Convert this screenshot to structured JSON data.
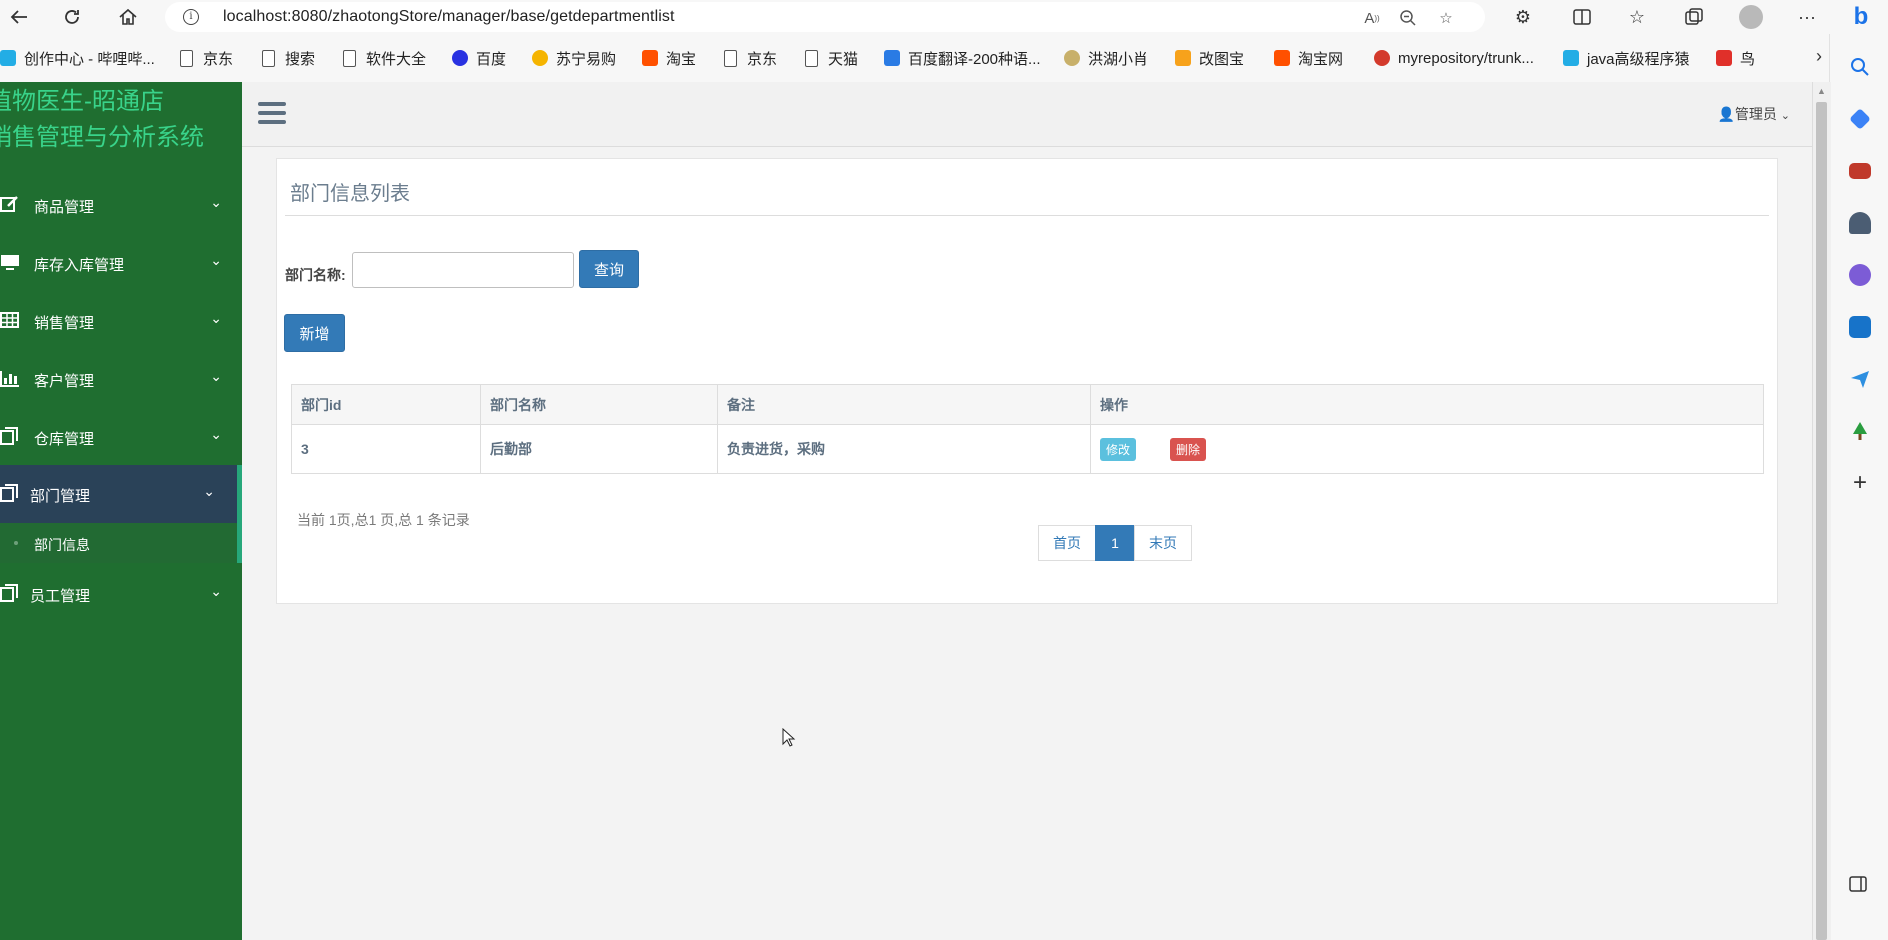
{
  "browser": {
    "url": "localhost:8080/zhaotongStore/manager/base/getdepartmentlist",
    "bookmarks": [
      {
        "label": "创作中心 - 哔哩哔...",
        "icon": "bilibili-icon"
      },
      {
        "label": "京东",
        "icon": "page-icon"
      },
      {
        "label": "搜索",
        "icon": "page-icon"
      },
      {
        "label": "软件大全",
        "icon": "page-icon"
      },
      {
        "label": "百度",
        "icon": "baidu-icon"
      },
      {
        "label": "苏宁易购",
        "icon": "suning-icon"
      },
      {
        "label": "淘宝",
        "icon": "taobao-icon"
      },
      {
        "label": "京东",
        "icon": "page-icon"
      },
      {
        "label": "天猫",
        "icon": "page-icon"
      },
      {
        "label": "百度翻译-200种语...",
        "icon": "translate-icon"
      },
      {
        "label": "洪湖小肖",
        "icon": "bird-icon"
      },
      {
        "label": "改图宝",
        "icon": "gaitubao-icon"
      },
      {
        "label": "淘宝网",
        "icon": "taobao-icon"
      },
      {
        "label": "myrepository/trunk...",
        "icon": "chrome-icon"
      },
      {
        "label": "java高级程序猿",
        "icon": "bilibili-icon"
      },
      {
        "label": "鸟",
        "icon": "bird-red-icon"
      }
    ]
  },
  "sidebar": {
    "brand_line1": "植物医生-昭通店",
    "brand_line2": "销售管理与分析系统",
    "items": [
      {
        "label": "商品管理",
        "icon": "edit-icon"
      },
      {
        "label": "库存入库管理",
        "icon": "desktop-icon"
      },
      {
        "label": "销售管理",
        "icon": "table-icon"
      },
      {
        "label": "客户管理",
        "icon": "bar-chart-icon"
      },
      {
        "label": "仓库管理",
        "icon": "copy-icon"
      },
      {
        "label": "部门管理",
        "icon": "copy-icon"
      },
      {
        "label": "员工管理",
        "icon": "copy-icon"
      }
    ],
    "sub_item": "部门信息"
  },
  "header": {
    "user": "管理员"
  },
  "panel": {
    "title": "部门信息列表",
    "search_label": "部门名称:",
    "search_value": "",
    "query_button": "查询",
    "add_button": "新增"
  },
  "table": {
    "headers": [
      "部门id",
      "部门名称",
      "备注",
      "操作"
    ],
    "rows": [
      {
        "id": "3",
        "name": "后勤部",
        "remark": "负责进货，采购",
        "edit": "修改",
        "delete": "删除"
      }
    ]
  },
  "pagination": {
    "info": "当前 1页,总1 页,总 1 条记录",
    "first": "首页",
    "current": "1",
    "last": "末页"
  },
  "colors": {
    "sidebar_bg": "#1f6e30",
    "brand_text": "#39d38a",
    "active_item_bg": "#2a4258",
    "primary": "#337ab7",
    "info": "#5bc0de",
    "danger": "#d9534f"
  }
}
